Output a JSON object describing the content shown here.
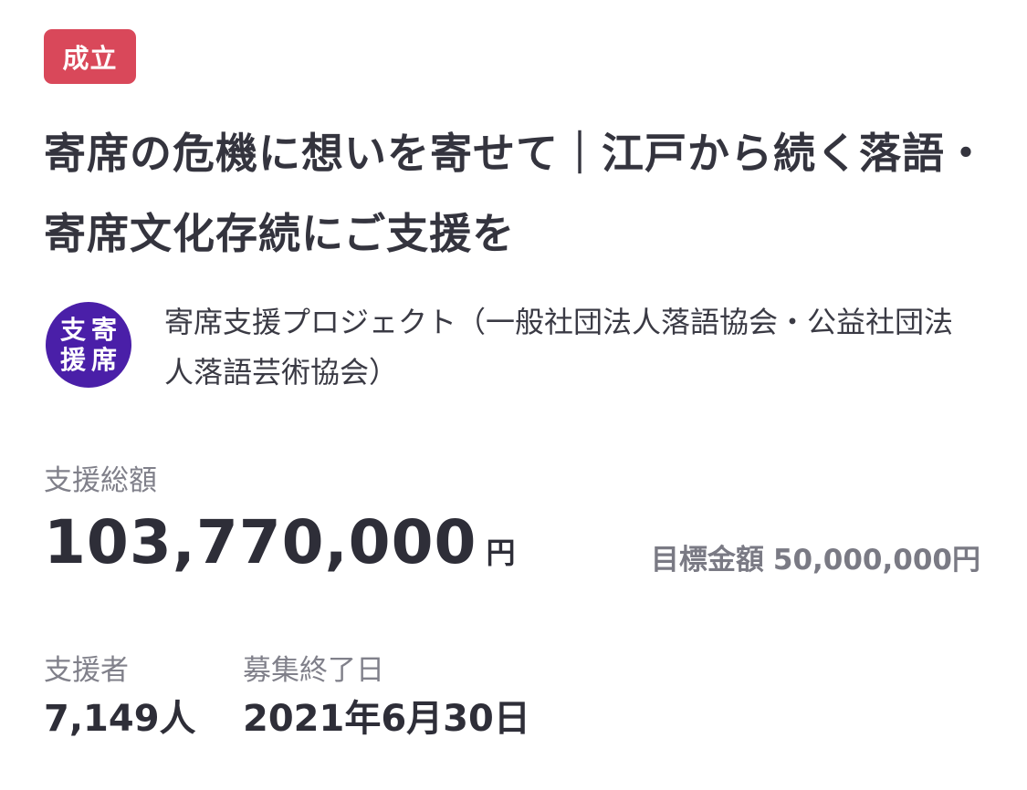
{
  "status_badge": {
    "label": "成立",
    "color": "#d9485a"
  },
  "project": {
    "title": "寄席の危機に想いを寄せて｜江戸から続く落語・寄席文化存続にご支援を"
  },
  "owner": {
    "name": "寄席支援プロジェクト（一般社団法人落語協会・公益社団法人落語芸術協会）",
    "avatar": {
      "icon": "yose-support-logo",
      "color": "#4a1fa8",
      "chars": [
        "支",
        "寄",
        "援",
        "席"
      ]
    }
  },
  "funding": {
    "total_label": "支援総額",
    "total_value": "103,770,000",
    "total_unit": "円",
    "goal_label": "目標金額",
    "goal_value": "50,000,000円"
  },
  "stats": {
    "supporters_label": "支援者",
    "supporters_value": "7,149人",
    "deadline_label": "募集終了日",
    "deadline_value": "2021年6月30日"
  }
}
